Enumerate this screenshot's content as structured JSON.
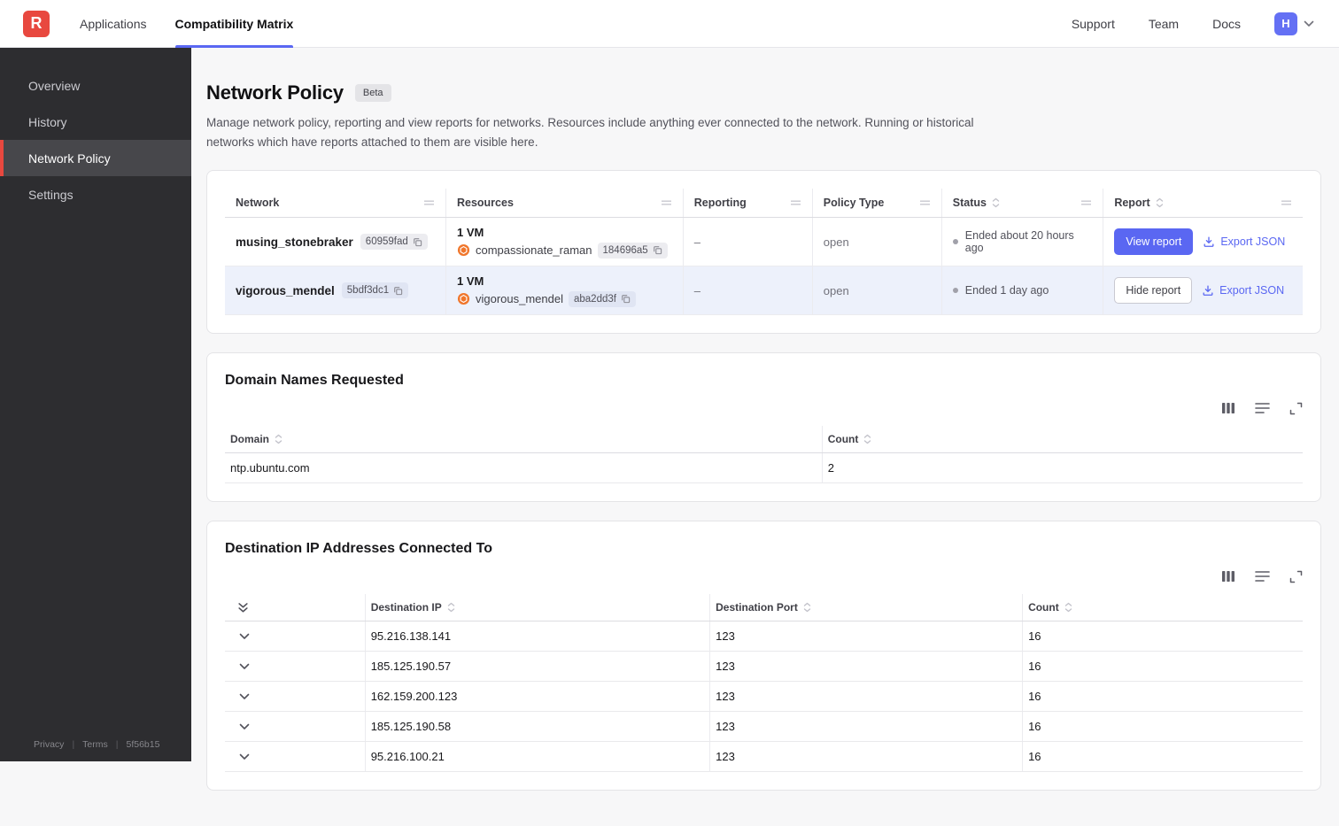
{
  "topbar": {
    "logo": "R",
    "nav": [
      {
        "label": "Applications"
      },
      {
        "label": "Compatibility Matrix"
      }
    ],
    "right_nav": [
      {
        "label": "Support"
      },
      {
        "label": "Team"
      },
      {
        "label": "Docs"
      }
    ],
    "avatar": "H"
  },
  "sidebar": {
    "items": [
      {
        "label": "Overview"
      },
      {
        "label": "History"
      },
      {
        "label": "Network Policy"
      },
      {
        "label": "Settings"
      }
    ],
    "footer": {
      "privacy": "Privacy",
      "terms": "Terms",
      "version": "5f56b15"
    }
  },
  "page": {
    "title": "Network Policy",
    "badge": "Beta",
    "description": "Manage network policy, reporting and view reports for networks. Resources include anything ever connected to the network. Running or historical networks which have reports attached to them are visible here."
  },
  "networks_table": {
    "columns": [
      "Network",
      "Resources",
      "Reporting",
      "Policy Type",
      "Status",
      "Report"
    ],
    "rows": [
      {
        "network": "musing_stonebraker",
        "network_id": "60959fad",
        "vm_count": "1 VM",
        "resource_name": "compassionate_raman",
        "resource_id": "184696a5",
        "reporting": "–",
        "policy_type": "open",
        "status": "Ended about 20 hours ago",
        "report_button": "View report",
        "export_label": "Export JSON"
      },
      {
        "network": "vigorous_mendel",
        "network_id": "5bdf3dc1",
        "vm_count": "1 VM",
        "resource_name": "vigorous_mendel",
        "resource_id": "aba2dd3f",
        "reporting": "–",
        "policy_type": "open",
        "status": "Ended 1 day ago",
        "report_button": "Hide report",
        "export_label": "Export JSON"
      }
    ]
  },
  "domains_card": {
    "title": "Domain Names Requested",
    "columns": [
      "Domain",
      "Count"
    ],
    "rows": [
      {
        "domain": "ntp.ubuntu.com",
        "count": "2"
      }
    ]
  },
  "destinations_card": {
    "title": "Destination IP Addresses Connected To",
    "columns": [
      "Destination IP",
      "Destination Port",
      "Count"
    ],
    "rows": [
      {
        "ip": "95.216.138.141",
        "port": "123",
        "count": "16"
      },
      {
        "ip": "185.125.190.57",
        "port": "123",
        "count": "16"
      },
      {
        "ip": "162.159.200.123",
        "port": "123",
        "count": "16"
      },
      {
        "ip": "185.125.190.58",
        "port": "123",
        "count": "16"
      },
      {
        "ip": "95.216.100.21",
        "port": "123",
        "count": "16"
      }
    ]
  },
  "colors": {
    "accent": "#5a67f2",
    "brand_red": "#e8483f",
    "row_highlight": "#edf1fb",
    "status_dot": "#a1a1aa",
    "resource_icon_orange": "#f0762b"
  },
  "icons": {
    "copy": "⧉",
    "download": "⭳",
    "sort": "⇅",
    "drag_handle": "≡",
    "columns_view": "▦",
    "rows_view": "≣",
    "expand": "⛶",
    "chevron_down": "⌄",
    "double_chevron_down": "⇊",
    "container": "●"
  }
}
